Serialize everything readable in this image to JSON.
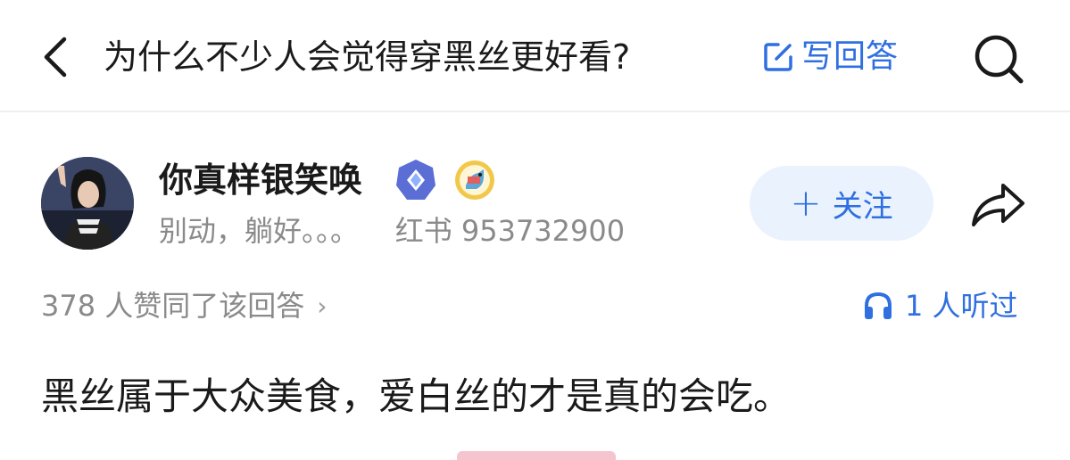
{
  "header": {
    "back_icon": "chevron-left-icon",
    "title": "为什么不少人会觉得穿黑丝更好看?",
    "write_answer_label": "写回答",
    "write_icon": "edit-icon",
    "search_icon": "search-icon",
    "accent_color": "#2f6fe0"
  },
  "author": {
    "name": "你真样银笑唤",
    "bio": "别动，躺好。。。    红书 953732900",
    "badges": [
      "verified-diamond-badge",
      "medal-badge"
    ],
    "follow_label": "关注",
    "follow_icon": "plus-icon",
    "share_icon": "share-arrow-icon"
  },
  "stats": {
    "votes_label": "378 人赞同了该回答",
    "votes_chevron": "›",
    "listen_label": "1 人听过",
    "listen_icon": "headphones-icon"
  },
  "answer": {
    "text": "黑丝属于大众美食，爱白丝的才是真的会吃。"
  }
}
